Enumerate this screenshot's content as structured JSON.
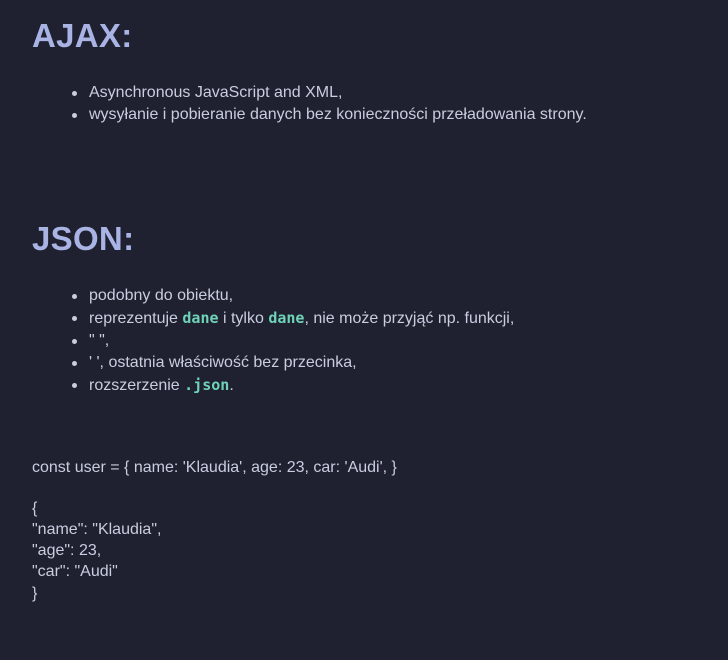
{
  "ajax": {
    "heading": "AJAX:",
    "items": [
      "Asynchronous JavaScript and XML,",
      "wysyłanie i pobieranie danych bez konieczności przeładowania strony."
    ]
  },
  "json": {
    "heading": "JSON:",
    "items": {
      "i0": "podobny do obiektu,",
      "i1_a": "reprezentuje ",
      "i1_code1": "dane",
      "i1_b": " i tylko ",
      "i1_code2": "dane",
      "i1_c": ", nie może przyjąć np. funkcji,",
      "i2": "\" \",",
      "i3": "' ', ostatnia właściwość bez przecinka,",
      "i4_a": "rozszerzenie ",
      "i4_code": ".json",
      "i4_b": "."
    }
  },
  "example": {
    "object_line": "const user = { name: 'Klaudia', age: 23, car: 'Audi', }",
    "json_lines": [
      "{",
      "\"name\": \"Klaudia\",",
      "\"age\": 23,",
      "\"car\": \"Audi\"",
      "}"
    ]
  },
  "colors": {
    "background": "#1f2130",
    "heading": "#a9b4e4",
    "text": "#c9cde0",
    "inline_code": "#6fd3b8"
  }
}
